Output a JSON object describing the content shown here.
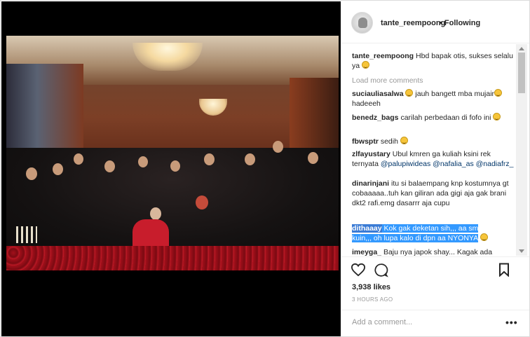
{
  "post": {
    "username": "tante_reempoong",
    "follow_status": "• Following",
    "likes": "3,938 likes",
    "time": "3 HOURS AGO",
    "add_comment_placeholder": "Add a comment...",
    "more_options": "•••"
  },
  "caption": {
    "user": "tante_reempoong",
    "text": "Hbd bapak otis, sukses selalu ya"
  },
  "load_more": "Load more comments",
  "comments": [
    {
      "user": "suciauliasalwa",
      "text": "jauh bangett mba mujair",
      "text2": "hadeeeh"
    },
    {
      "user": "benedz_bags",
      "text": "carilah perbedaan di fofo ini"
    },
    {
      "user": "fbwsptr",
      "text": "sedih"
    },
    {
      "user": "zlfayustary",
      "text": "Ubul kmren ga kuliah ksini rek ternyata",
      "mention1": "@palupiwideas",
      "mention2": "@nafalia_as",
      "mention3": "@nadiafrz_"
    },
    {
      "user": "dinarinjani",
      "text": "itu si balaempang knp kostumnya gt cobaaaaa..tuh kan giliran ada gigi aja gak brani dkt2 rafi.emg dasarrr aja cupu"
    },
    {
      "user": "dithaaay",
      "text1": "Kok gak deketan sih,,, aa sm",
      "text2": "kuin,,, oh lupa kalo di dpn aa NYONYA"
    },
    {
      "user": "imeyga_",
      "text": "Baju nya japok shay... Kagak ada"
    }
  ],
  "icons": [
    "heart-icon",
    "comment-icon",
    "bookmark-icon",
    "more-options-icon"
  ],
  "colors": {
    "selection": "#3399ff",
    "link": "#003569",
    "muted": "#999999"
  }
}
